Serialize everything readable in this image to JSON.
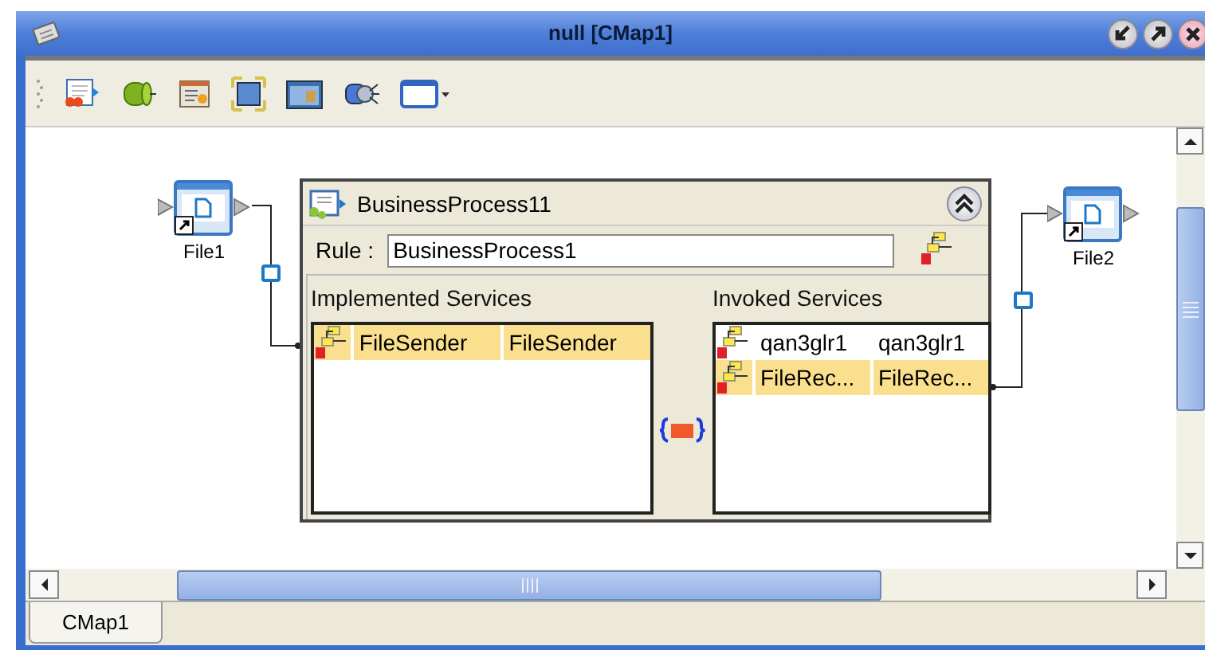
{
  "window": {
    "title": "null [CMap1]"
  },
  "canvas": {
    "nodes": [
      {
        "label": "File1"
      },
      {
        "label": "File2"
      }
    ],
    "process": {
      "title": "BusinessProcess11",
      "rule_label": "Rule :",
      "rule_value": "BusinessProcess1",
      "implemented": {
        "heading": "Implemented Services",
        "rows": [
          {
            "cells": [
              "FileSender",
              "FileSender"
            ],
            "selected": true
          }
        ]
      },
      "invoked": {
        "heading": "Invoked Services",
        "rows": [
          {
            "cells": [
              "qan3glr1",
              "qan3glr1"
            ],
            "selected": false
          },
          {
            "cells": [
              "FileRec...",
              "FileRec..."
            ],
            "selected": true
          }
        ]
      }
    }
  },
  "tabs": [
    {
      "label": "CMap1",
      "selected": true
    }
  ]
}
